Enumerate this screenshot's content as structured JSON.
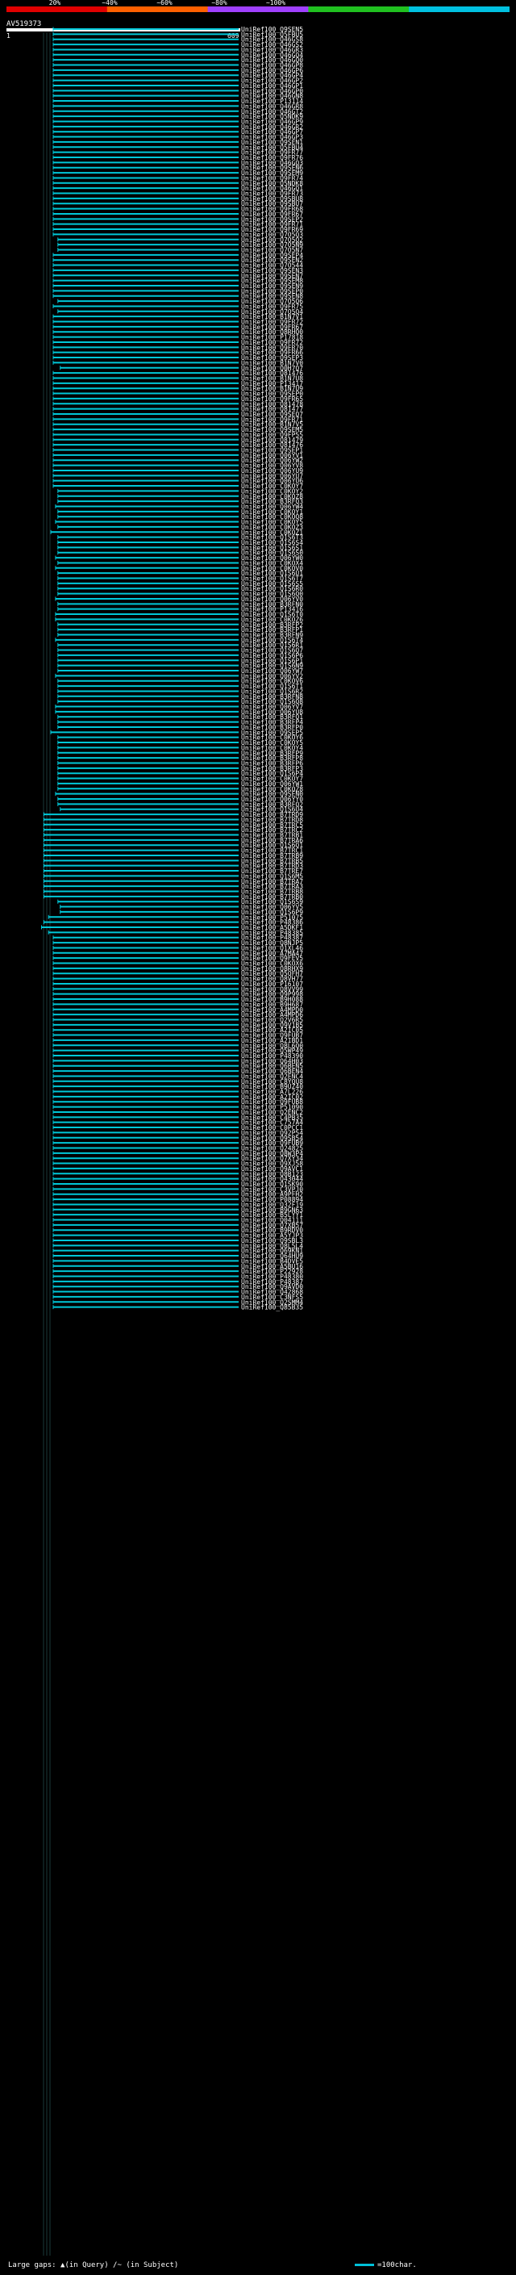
{
  "header": {
    "percent_labels": [
      "20%",
      "~40%",
      "~60%",
      "~80%",
      "~100%"
    ],
    "color_stops": [
      "#e00000",
      "#ff6000",
      "#a040ff",
      "#20c020",
      "#00c0e0"
    ],
    "query_id": "AV519373",
    "query_start": "1",
    "query_end": "609"
  },
  "hit_color": "#00c8d8",
  "hits": [
    {
      "acc": "UniRef100_Q9SEN5",
      "start": 0.2
    },
    {
      "acc": "UniRef100_Q5FBU5",
      "start": 0.2
    },
    {
      "acc": "UniRef100_Q46GS8",
      "start": 0.2
    },
    {
      "acc": "UniRef100_Q46GS2",
      "start": 0.2
    },
    {
      "acc": "UniRef100_Q46GR3",
      "start": 0.2
    },
    {
      "acc": "UniRef100_Q46GQ4",
      "start": 0.2
    },
    {
      "acc": "UniRef100_Q46GQ0",
      "start": 0.2
    },
    {
      "acc": "UniRef100_Q46GP8",
      "start": 0.2
    },
    {
      "acc": "UniRef100_Q46GP6",
      "start": 0.2
    },
    {
      "acc": "UniRef100_Q46GP4",
      "start": 0.2
    },
    {
      "acc": "UniRef100_Q46GP2",
      "start": 0.2
    },
    {
      "acc": "UniRef100_Q46GP1",
      "start": 0.2
    },
    {
      "acc": "UniRef100_Q46GP0",
      "start": 0.2
    },
    {
      "acc": "UniRef100_Q46GN8",
      "start": 0.2
    },
    {
      "acc": "UniRef100_P13114",
      "start": 0.2
    },
    {
      "acc": "UniRef100_Q46GR8",
      "start": 0.2
    },
    {
      "acc": "UniRef100_Q46GT2",
      "start": 0.2
    },
    {
      "acc": "UniRef100_Q5NDK9",
      "start": 0.2
    },
    {
      "acc": "UniRef100_Q46GP9",
      "start": 0.2
    },
    {
      "acc": "UniRef100_Q46GR2",
      "start": 0.2
    },
    {
      "acc": "UniRef100_Q46GP7",
      "start": 0.2
    },
    {
      "acc": "UniRef100_Q46GP3",
      "start": 0.2
    },
    {
      "acc": "UniRef100_Q9SEN1",
      "start": 0.2
    },
    {
      "acc": "UniRef100_Q5FBU4",
      "start": 0.2
    },
    {
      "acc": "UniRef100_Q9FR77",
      "start": 0.2
    },
    {
      "acc": "UniRef100_Q9FR76",
      "start": 0.2
    },
    {
      "acc": "UniRef100_Q46GQ3",
      "start": 0.2
    },
    {
      "acc": "UniRef100_Q9SEN6",
      "start": 0.2
    },
    {
      "acc": "UniRef100_Q9SEM9",
      "start": 0.2
    },
    {
      "acc": "UniRef100_Q9FR74",
      "start": 0.2
    },
    {
      "acc": "UniRef100_Q5NDK8",
      "start": 0.2
    },
    {
      "acc": "UniRef100_Q46GQ1",
      "start": 0.2
    },
    {
      "acc": "UniRef100_Q9FR73",
      "start": 0.2
    },
    {
      "acc": "UniRef100_Q9SBU8",
      "start": 0.2
    },
    {
      "acc": "UniRef100_Q9SBU7",
      "start": 0.2
    },
    {
      "acc": "UniRef100_Q9FR68",
      "start": 0.2
    },
    {
      "acc": "UniRef100_Q9FR67",
      "start": 0.2
    },
    {
      "acc": "UniRef100_Q9SEP2",
      "start": 0.2
    },
    {
      "acc": "UniRef100_Q9FR71",
      "start": 0.2
    },
    {
      "acc": "UniRef100_Q9FR69",
      "start": 0.2
    },
    {
      "acc": "UniRef100_Q7O5Q3",
      "start": 0.2
    },
    {
      "acc": "UniRef100_Q7O5Q2",
      "start": 0.22
    },
    {
      "acc": "UniRef100_Q7O5N9",
      "start": 0.22
    },
    {
      "acc": "UniRef100_Q7O5N7",
      "start": 0.22
    },
    {
      "acc": "UniRef100_Q9SEP4",
      "start": 0.2
    },
    {
      "acc": "UniRef100_Q9SEN2",
      "start": 0.2
    },
    {
      "acc": "UniRef100_Q7O544",
      "start": 0.2
    },
    {
      "acc": "UniRef100_Q9SEN3",
      "start": 0.2
    },
    {
      "acc": "UniRef100_Q9SEN7",
      "start": 0.2
    },
    {
      "acc": "UniRef100_Q9SEM8",
      "start": 0.2
    },
    {
      "acc": "UniRef100_Q9SEN9",
      "start": 0.2
    },
    {
      "acc": "UniRef100_Q9SEP0",
      "start": 0.2
    },
    {
      "acc": "UniRef100_Q9SEN8",
      "start": 0.2
    },
    {
      "acc": "UniRef100_Q7O5Q6",
      "start": 0.22
    },
    {
      "acc": "UniRef100_Q9FR75",
      "start": 0.2
    },
    {
      "acc": "UniRef100_Q7O5Q4",
      "start": 0.22
    },
    {
      "acc": "UniRef100_B1N7V1",
      "start": 0.2
    },
    {
      "acc": "UniRef100_Q9FR72",
      "start": 0.2
    },
    {
      "acc": "UniRef100_Q9FR67",
      "start": 0.2
    },
    {
      "acc": "UniRef100_Q8RHQ0",
      "start": 0.2
    },
    {
      "acc": "UniRef100_P17818",
      "start": 0.2
    },
    {
      "acc": "UniRef100_Q9FR72",
      "start": 0.2
    },
    {
      "acc": "UniRef100_Q9FR70",
      "start": 0.2
    },
    {
      "acc": "UniRef100_Q9FR66",
      "start": 0.2
    },
    {
      "acc": "UniRef100_Q9SEP3",
      "start": 0.2
    },
    {
      "acc": "UniRef100_B1N7V0",
      "start": 0.2
    },
    {
      "acc": "UniRef100_Q0H7Q7",
      "start": 0.23
    },
    {
      "acc": "UniRef100_Q81476",
      "start": 0.2
    },
    {
      "acc": "UniRef100_B1N7U8",
      "start": 0.2
    },
    {
      "acc": "UniRef100_P13417",
      "start": 0.2
    },
    {
      "acc": "UniRef100_B1N7U9",
      "start": 0.2
    },
    {
      "acc": "UniRef100_Q9SEP0",
      "start": 0.2
    },
    {
      "acc": "UniRef100_Q9FR65",
      "start": 0.2
    },
    {
      "acc": "UniRef100_Q81478",
      "start": 0.2
    },
    {
      "acc": "UniRef100_Q81477",
      "start": 0.2
    },
    {
      "acc": "UniRef100_Q9SEQ7",
      "start": 0.2
    },
    {
      "acc": "UniRef100_Q9FR71",
      "start": 0.2
    },
    {
      "acc": "UniRef100_B1N7V5",
      "start": 0.2
    },
    {
      "acc": "UniRef100_Q9SEM5",
      "start": 0.2
    },
    {
      "acc": "UniRef100_Q9FP55",
      "start": 0.2
    },
    {
      "acc": "UniRef100_Q81479",
      "start": 0.2
    },
    {
      "acc": "UniRef100_Q81476",
      "start": 0.2
    },
    {
      "acc": "UniRef100_Q9SEP1",
      "start": 0.2
    },
    {
      "acc": "UniRef100_Q06YV1",
      "start": 0.2
    },
    {
      "acc": "UniRef100_Q06YW2",
      "start": 0.2
    },
    {
      "acc": "UniRef100_Q06YV8",
      "start": 0.2
    },
    {
      "acc": "UniRef100_Q06YU9",
      "start": 0.2
    },
    {
      "acc": "UniRef100_Q06YU7",
      "start": 0.2
    },
    {
      "acc": "UniRef100_Q06YU6",
      "start": 0.2
    },
    {
      "acc": "UniRef100_C0KOY7",
      "start": 0.2
    },
    {
      "acc": "UniRef100_C0KOY2",
      "start": 0.22
    },
    {
      "acc": "UniRef100_C0KOZ8",
      "start": 0.22
    },
    {
      "acc": "UniRef100_B3RFQ3",
      "start": 0.22
    },
    {
      "acc": "UniRef100_Q06YW4",
      "start": 0.21
    },
    {
      "acc": "UniRef100_C0KOY1",
      "start": 0.22
    },
    {
      "acc": "UniRef100_C0KOQ8",
      "start": 0.22
    },
    {
      "acc": "UniRef100_C0KOY5",
      "start": 0.21
    },
    {
      "acc": "UniRef100_C0KOZ3",
      "start": 0.22
    },
    {
      "acc": "UniRef100_C0KOZ1",
      "start": 0.19
    },
    {
      "acc": "UniRef100_Q1S6T3",
      "start": 0.22
    },
    {
      "acc": "UniRef100_Q1S6S4",
      "start": 0.22
    },
    {
      "acc": "UniRef100_Q1S6S1",
      "start": 0.22
    },
    {
      "acc": "UniRef100_Q1S6S0",
      "start": 0.22
    },
    {
      "acc": "UniRef100_Q06YW0",
      "start": 0.21
    },
    {
      "acc": "UniRef100_C0KOX4",
      "start": 0.22
    },
    {
      "acc": "UniRef100_C0KOV0",
      "start": 0.21
    },
    {
      "acc": "UniRef100_Q1S6U1",
      "start": 0.22
    },
    {
      "acc": "UniRef100_Q1S6T7",
      "start": 0.22
    },
    {
      "acc": "UniRef100_Q1S6S5",
      "start": 0.22
    },
    {
      "acc": "UniRef100_Q1S6R0",
      "start": 0.22
    },
    {
      "acc": "UniRef100_Q1S6Q0",
      "start": 0.22
    },
    {
      "acc": "UniRef100_Q06YV0",
      "start": 0.21
    },
    {
      "acc": "UniRef100_B3RFN0",
      "start": 0.22
    },
    {
      "acc": "UniRef100_P13416",
      "start": 0.22
    },
    {
      "acc": "UniRef100_Q1S6T0",
      "start": 0.21
    },
    {
      "acc": "UniRef100_C0KOZ6",
      "start": 0.21
    },
    {
      "acc": "UniRef100_B3RFP2",
      "start": 0.22
    },
    {
      "acc": "UniRef100_B3RFP1",
      "start": 0.22
    },
    {
      "acc": "UniRef100_B3RFN9",
      "start": 0.22
    },
    {
      "acc": "UniRef100_Q1S6T4",
      "start": 0.21
    },
    {
      "acc": "UniRef100_Q1S6R1",
      "start": 0.22
    },
    {
      "acc": "UniRef100_Q1S6Q7",
      "start": 0.22
    },
    {
      "acc": "UniRef100_Q1S6P6",
      "start": 0.22
    },
    {
      "acc": "UniRef100_Q1S6P1",
      "start": 0.22
    },
    {
      "acc": "UniRef100_Q1S6N9",
      "start": 0.22
    },
    {
      "acc": "UniRef100_Q06YW7",
      "start": 0.22
    },
    {
      "acc": "UniRef100_Q06YV2",
      "start": 0.21
    },
    {
      "acc": "UniRef100_C0KOV6",
      "start": 0.22
    },
    {
      "acc": "UniRef100_Q1S6T1",
      "start": 0.22
    },
    {
      "acc": "UniRef100_Q1S6R2",
      "start": 0.22
    },
    {
      "acc": "UniRef100_B3RFN8",
      "start": 0.22
    },
    {
      "acc": "UniRef100_Q1S6Q8",
      "start": 0.22
    },
    {
      "acc": "UniRef100_Q06YV7",
      "start": 0.21
    },
    {
      "acc": "UniRef100_Q06YU8",
      "start": 0.21
    },
    {
      "acc": "UniRef100_B3RFQ1",
      "start": 0.22
    },
    {
      "acc": "UniRef100_B3RFP4",
      "start": 0.22
    },
    {
      "acc": "UniRef100_B3RFP0",
      "start": 0.22
    },
    {
      "acc": "UniRef100_Q9SEP5",
      "start": 0.19
    },
    {
      "acc": "UniRef100_C0KOY6",
      "start": 0.22
    },
    {
      "acc": "UniRef100_C0KOY5",
      "start": 0.22
    },
    {
      "acc": "UniRef100_C0KOY4",
      "start": 0.22
    },
    {
      "acc": "UniRef100_B3RFP9",
      "start": 0.22
    },
    {
      "acc": "UniRef100_B3RFP8",
      "start": 0.22
    },
    {
      "acc": "UniRef100_B3RFP6",
      "start": 0.22
    },
    {
      "acc": "UniRef100_B3RFP3",
      "start": 0.22
    },
    {
      "acc": "UniRef100_Q1S6P4",
      "start": 0.22
    },
    {
      "acc": "UniRef100_C0KOY7",
      "start": 0.22
    },
    {
      "acc": "UniRef100_Q06YW1",
      "start": 0.22
    },
    {
      "acc": "UniRef100_C0KOZ8",
      "start": 0.22
    },
    {
      "acc": "UniRef100_Q9SEN0",
      "start": 0.21
    },
    {
      "acc": "UniRef100_Q06YY0",
      "start": 0.22
    },
    {
      "acc": "UniRef100_B3RFQ2",
      "start": 0.22
    },
    {
      "acc": "UniRef100_Q1S6U4",
      "start": 0.23
    },
    {
      "acc": "UniRef100_B7TRD9",
      "start": 0.16
    },
    {
      "acc": "UniRef100_B7TRD8",
      "start": 0.16
    },
    {
      "acc": "UniRef100_B7TRC5",
      "start": 0.16
    },
    {
      "acc": "UniRef100_B7TRC2",
      "start": 0.16
    },
    {
      "acc": "UniRef100_B7TRB1",
      "start": 0.16
    },
    {
      "acc": "UniRef100_B7TRA6",
      "start": 0.16
    },
    {
      "acc": "UniRef100_Q1S6Q1",
      "start": 0.16
    },
    {
      "acc": "UniRef100_B7TRC1",
      "start": 0.16
    },
    {
      "acc": "UniRef100_B7TRB9",
      "start": 0.16
    },
    {
      "acc": "UniRef100_B7TRB5",
      "start": 0.16
    },
    {
      "acc": "UniRef100_B7TRD3",
      "start": 0.16
    },
    {
      "acc": "UniRef100_B7TRE7",
      "start": 0.16
    },
    {
      "acc": "UniRef100_Q1S6M5",
      "start": 0.16
    },
    {
      "acc": "UniRef100_B7TRA7",
      "start": 0.16
    },
    {
      "acc": "UniRef100_B7TRA3",
      "start": 0.16
    },
    {
      "acc": "UniRef100_B7TRB8",
      "start": 0.16
    },
    {
      "acc": "UniRef100_B7TRB0",
      "start": 0.16
    },
    {
      "acc": "UniRef100_Q1S6S9",
      "start": 0.22
    },
    {
      "acc": "UniRef100_Q06YV5",
      "start": 0.23
    },
    {
      "acc": "UniRef100_Q1S6P9",
      "start": 0.23
    },
    {
      "acc": "UniRef100_P51075",
      "start": 0.18
    },
    {
      "acc": "UniRef100_P48386",
      "start": 0.16
    },
    {
      "acc": "UniRef100_A5DKF1",
      "start": 0.15
    },
    {
      "acc": "UniRef100_P48385",
      "start": 0.18
    },
    {
      "acc": "UniRef100_P48387",
      "start": 0.2
    },
    {
      "acc": "UniRef100_Q8NJP5",
      "start": 0.2
    },
    {
      "acc": "UniRef100_Q1XL46",
      "start": 0.2
    },
    {
      "acc": "UniRef100_A7MA47",
      "start": 0.2
    },
    {
      "acc": "UniRef100_Q9FEV5",
      "start": 0.2
    },
    {
      "acc": "UniRef100_C0KOX6",
      "start": 0.2
    },
    {
      "acc": "UniRef100_Q8RHX9",
      "start": 0.2
    },
    {
      "acc": "UniRef100_Q5QFH7",
      "start": 0.2
    },
    {
      "acc": "UniRef100_Q8VH77",
      "start": 0.2
    },
    {
      "acc": "UniRef100_P16107",
      "start": 0.2
    },
    {
      "acc": "UniRef100_Q8VV99",
      "start": 0.2
    },
    {
      "acc": "UniRef100_Q9P998",
      "start": 0.2
    },
    {
      "acc": "UniRef100_B9H088",
      "start": 0.2
    },
    {
      "acc": "UniRef100_B9H687",
      "start": 0.2
    },
    {
      "acc": "UniRef100_A4MPD0",
      "start": 0.2
    },
    {
      "acc": "UniRef100_A4MPD6",
      "start": 0.2
    },
    {
      "acc": "UniRef100_Q2V6R5",
      "start": 0.2
    },
    {
      "acc": "UniRef100_Q9V1B5",
      "start": 0.2
    },
    {
      "acc": "UniRef100_A2IC05",
      "start": 0.2
    },
    {
      "acc": "UniRef100_Q9FUB7",
      "start": 0.2
    },
    {
      "acc": "UniRef100_A2IBD1",
      "start": 0.2
    },
    {
      "acc": "UniRef100_Q8L6Q0",
      "start": 0.2
    },
    {
      "acc": "UniRef100_Q5WP49",
      "start": 0.2
    },
    {
      "acc": "UniRef100_P48390",
      "start": 0.2
    },
    {
      "acc": "UniRef100_Q64H03",
      "start": 0.2
    },
    {
      "acc": "UniRef100_Q6BEN5",
      "start": 0.2
    },
    {
      "acc": "UniRef100_Q6BEN4",
      "start": 0.2
    },
    {
      "acc": "UniRef100_Q2ENC4",
      "start": 0.2
    },
    {
      "acc": "UniRef100_C8YQU8",
      "start": 0.2
    },
    {
      "acc": "UniRef100_B9UZ40",
      "start": 0.2
    },
    {
      "acc": "UniRef100_A7L226",
      "start": 0.2
    },
    {
      "acc": "UniRef100_A2IC02",
      "start": 0.2
    },
    {
      "acc": "UniRef100_Q9FUB8",
      "start": 0.2
    },
    {
      "acc": "UniRef100_P51090",
      "start": 0.2
    },
    {
      "acc": "UniRef100_Q2ENC2",
      "start": 0.2
    },
    {
      "acc": "UniRef100_C4PB35",
      "start": 0.2
    },
    {
      "acc": "UniRef100_C757A4",
      "start": 0.2
    },
    {
      "acc": "UniRef100_C0PCC1",
      "start": 0.2
    },
    {
      "acc": "UniRef100_Q92P54",
      "start": 0.2
    },
    {
      "acc": "UniRef100_Q9SB54",
      "start": 0.2
    },
    {
      "acc": "UniRef100_Q9FUB9",
      "start": 0.2
    },
    {
      "acc": "UniRef100_Q24825",
      "start": 0.2
    },
    {
      "acc": "UniRef100_Q8W3P4",
      "start": 0.2
    },
    {
      "acc": "UniRef100_Q7XY34",
      "start": 0.2
    },
    {
      "acc": "UniRef100_Q9XJ58",
      "start": 0.2
    },
    {
      "acc": "UniRef100_Q9AVC1",
      "start": 0.2
    },
    {
      "acc": "UniRef100_Q8B123",
      "start": 0.2
    },
    {
      "acc": "UniRef100_Q43044",
      "start": 0.2
    },
    {
      "acc": "UniRef100_Q1SK90",
      "start": 0.2
    },
    {
      "acc": "UniRef100_C3VPJ0",
      "start": 0.2
    },
    {
      "acc": "UniRef100_A9PFH2",
      "start": 0.2
    },
    {
      "acc": "UniRef100_P08894",
      "start": 0.2
    },
    {
      "acc": "UniRef100_Q32F19",
      "start": 0.2
    },
    {
      "acc": "UniRef100_B9GN63",
      "start": 0.2
    },
    {
      "acc": "UniRef100_B5LYY1",
      "start": 0.2
    },
    {
      "acc": "UniRef100_Q04111",
      "start": 0.2
    },
    {
      "acc": "UniRef100_Q7XB57",
      "start": 0.2
    },
    {
      "acc": "UniRef100_B9RDV0",
      "start": 0.2
    },
    {
      "acc": "UniRef100_A5YJP3",
      "start": 0.2
    },
    {
      "acc": "UniRef100_Q9SBL3",
      "start": 0.2
    },
    {
      "acc": "UniRef100_Q8L5L4",
      "start": 0.2
    },
    {
      "acc": "UniRef100_Q69KN1",
      "start": 0.2
    },
    {
      "acc": "UniRef100_Q64HU9",
      "start": 0.2
    },
    {
      "acc": "UniRef100_B4DVE5",
      "start": 0.2
    },
    {
      "acc": "UniRef100_A5BU16",
      "start": 0.2
    },
    {
      "acc": "UniRef100_P22928",
      "start": 0.2
    },
    {
      "acc": "UniRef100_P48380",
      "start": 0.2
    },
    {
      "acc": "UniRef100_P48387",
      "start": 0.2
    },
    {
      "acc": "UniRef100_Q9AVD0",
      "start": 0.2
    },
    {
      "acc": "UniRef100_Q42868",
      "start": 0.2
    },
    {
      "acc": "UniRef100_C3NFS5",
      "start": 0.2
    },
    {
      "acc": "UniRef100_Q2SMM4",
      "start": 0.2
    },
    {
      "acc": "UniRef100_Q85B35",
      "start": 0.2
    }
  ],
  "footer": {
    "large_gaps_label": "Large gaps:",
    "in_query": "(in Query)",
    "in_subject": "(in Subject)",
    "scale_label": "=100char."
  }
}
